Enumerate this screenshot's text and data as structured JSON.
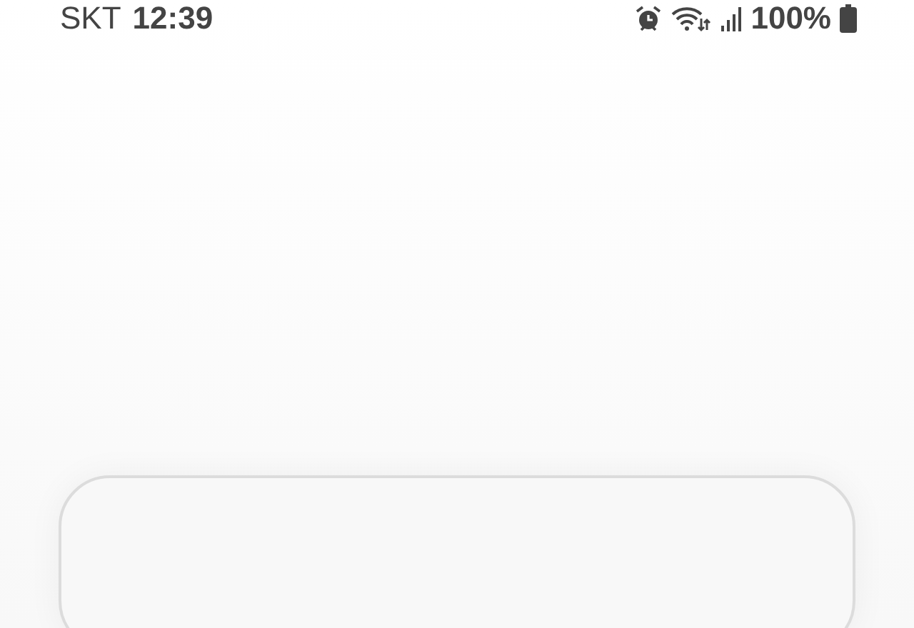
{
  "status_bar": {
    "carrier": "SKT",
    "time": "12:39",
    "battery": "100%"
  }
}
